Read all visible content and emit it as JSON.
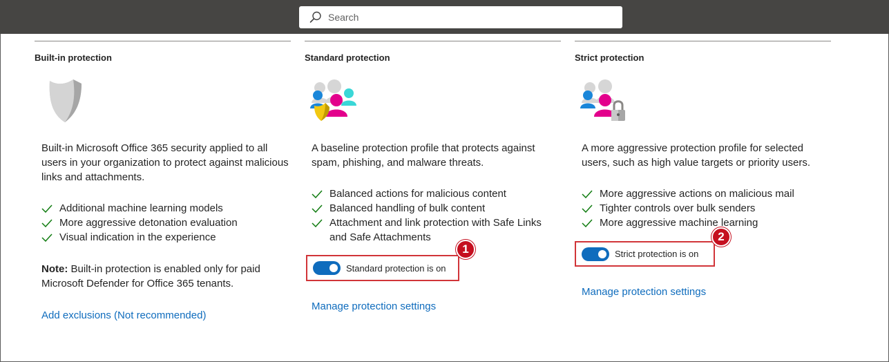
{
  "search": {
    "placeholder": "Search"
  },
  "columns": [
    {
      "title": "Built-in protection",
      "description": "Built-in Microsoft Office 365 security applied to all users in your organization to protect against malicious links and attachments.",
      "features": [
        "Additional machine learning models",
        "More aggressive detonation evaluation",
        "Visual indication in the experience"
      ],
      "note_label": "Note:",
      "note_text": " Built-in protection is enabled only for paid Microsoft Defender for Office 365 tenants.",
      "link": "Add exclusions (Not recommended)"
    },
    {
      "title": "Standard protection",
      "description": "A baseline protection profile that protects against spam, phishing, and malware threats.",
      "features": [
        "Balanced actions for malicious content",
        "Balanced handling of bulk content",
        "Attachment and link protection with Safe Links and Safe Attachments"
      ],
      "toggle_label": "Standard protection is on",
      "toggle_on": true,
      "marker": "1",
      "link": "Manage protection settings"
    },
    {
      "title": "Strict protection",
      "description": "A more aggressive protection profile for selected users, such as high value targets or priority users.",
      "features": [
        "More aggressive actions on malicious mail",
        "Tighter controls over bulk senders",
        "More aggressive machine learning"
      ],
      "toggle_label": "Strict protection is on",
      "toggle_on": true,
      "marker": "2",
      "link": "Manage protection settings"
    }
  ],
  "colors": {
    "accent": "#0f6cbd",
    "highlight": "#d13438",
    "check": "#107c10",
    "topbar": "#464543"
  },
  "icons": {
    "search": "search-icon",
    "check": "checkmark-icon",
    "builtin": "shield-illustration",
    "standard": "users-shield-illustration",
    "strict": "users-lock-illustration"
  }
}
